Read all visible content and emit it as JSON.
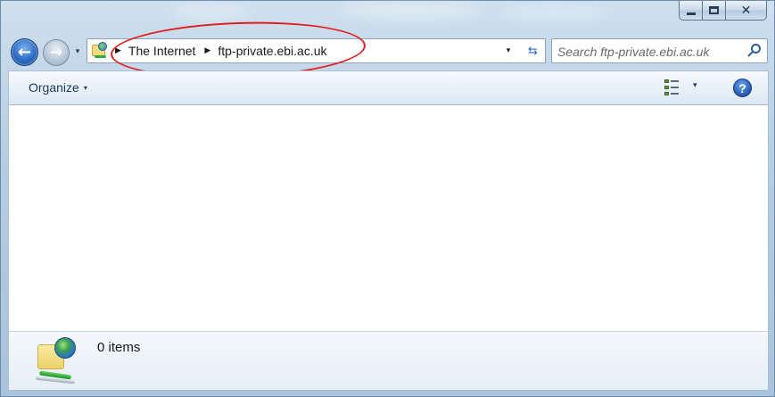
{
  "window": {
    "caption": {
      "minimize_glyph": "",
      "maximize_glyph": "",
      "close_glyph": "✕"
    }
  },
  "nav": {
    "back_glyph": "←",
    "forward_glyph": "→",
    "history_glyph": "▾"
  },
  "address": {
    "separator_glyph": "▶",
    "crumbs": [
      "The Internet",
      "ftp-private.ebi.ac.uk"
    ],
    "dropdown_glyph": "▾",
    "refresh_glyph": "⇆"
  },
  "search": {
    "placeholder": "Search ftp-private.ebi.ac.uk"
  },
  "command_bar": {
    "organize_label": "Organize",
    "organize_caret": "▾",
    "views_caret": "▾",
    "help_label": "?"
  },
  "details": {
    "item_count": "0 items"
  },
  "colors": {
    "annotation": "#e11f1f",
    "accent": "#2b62bb"
  }
}
